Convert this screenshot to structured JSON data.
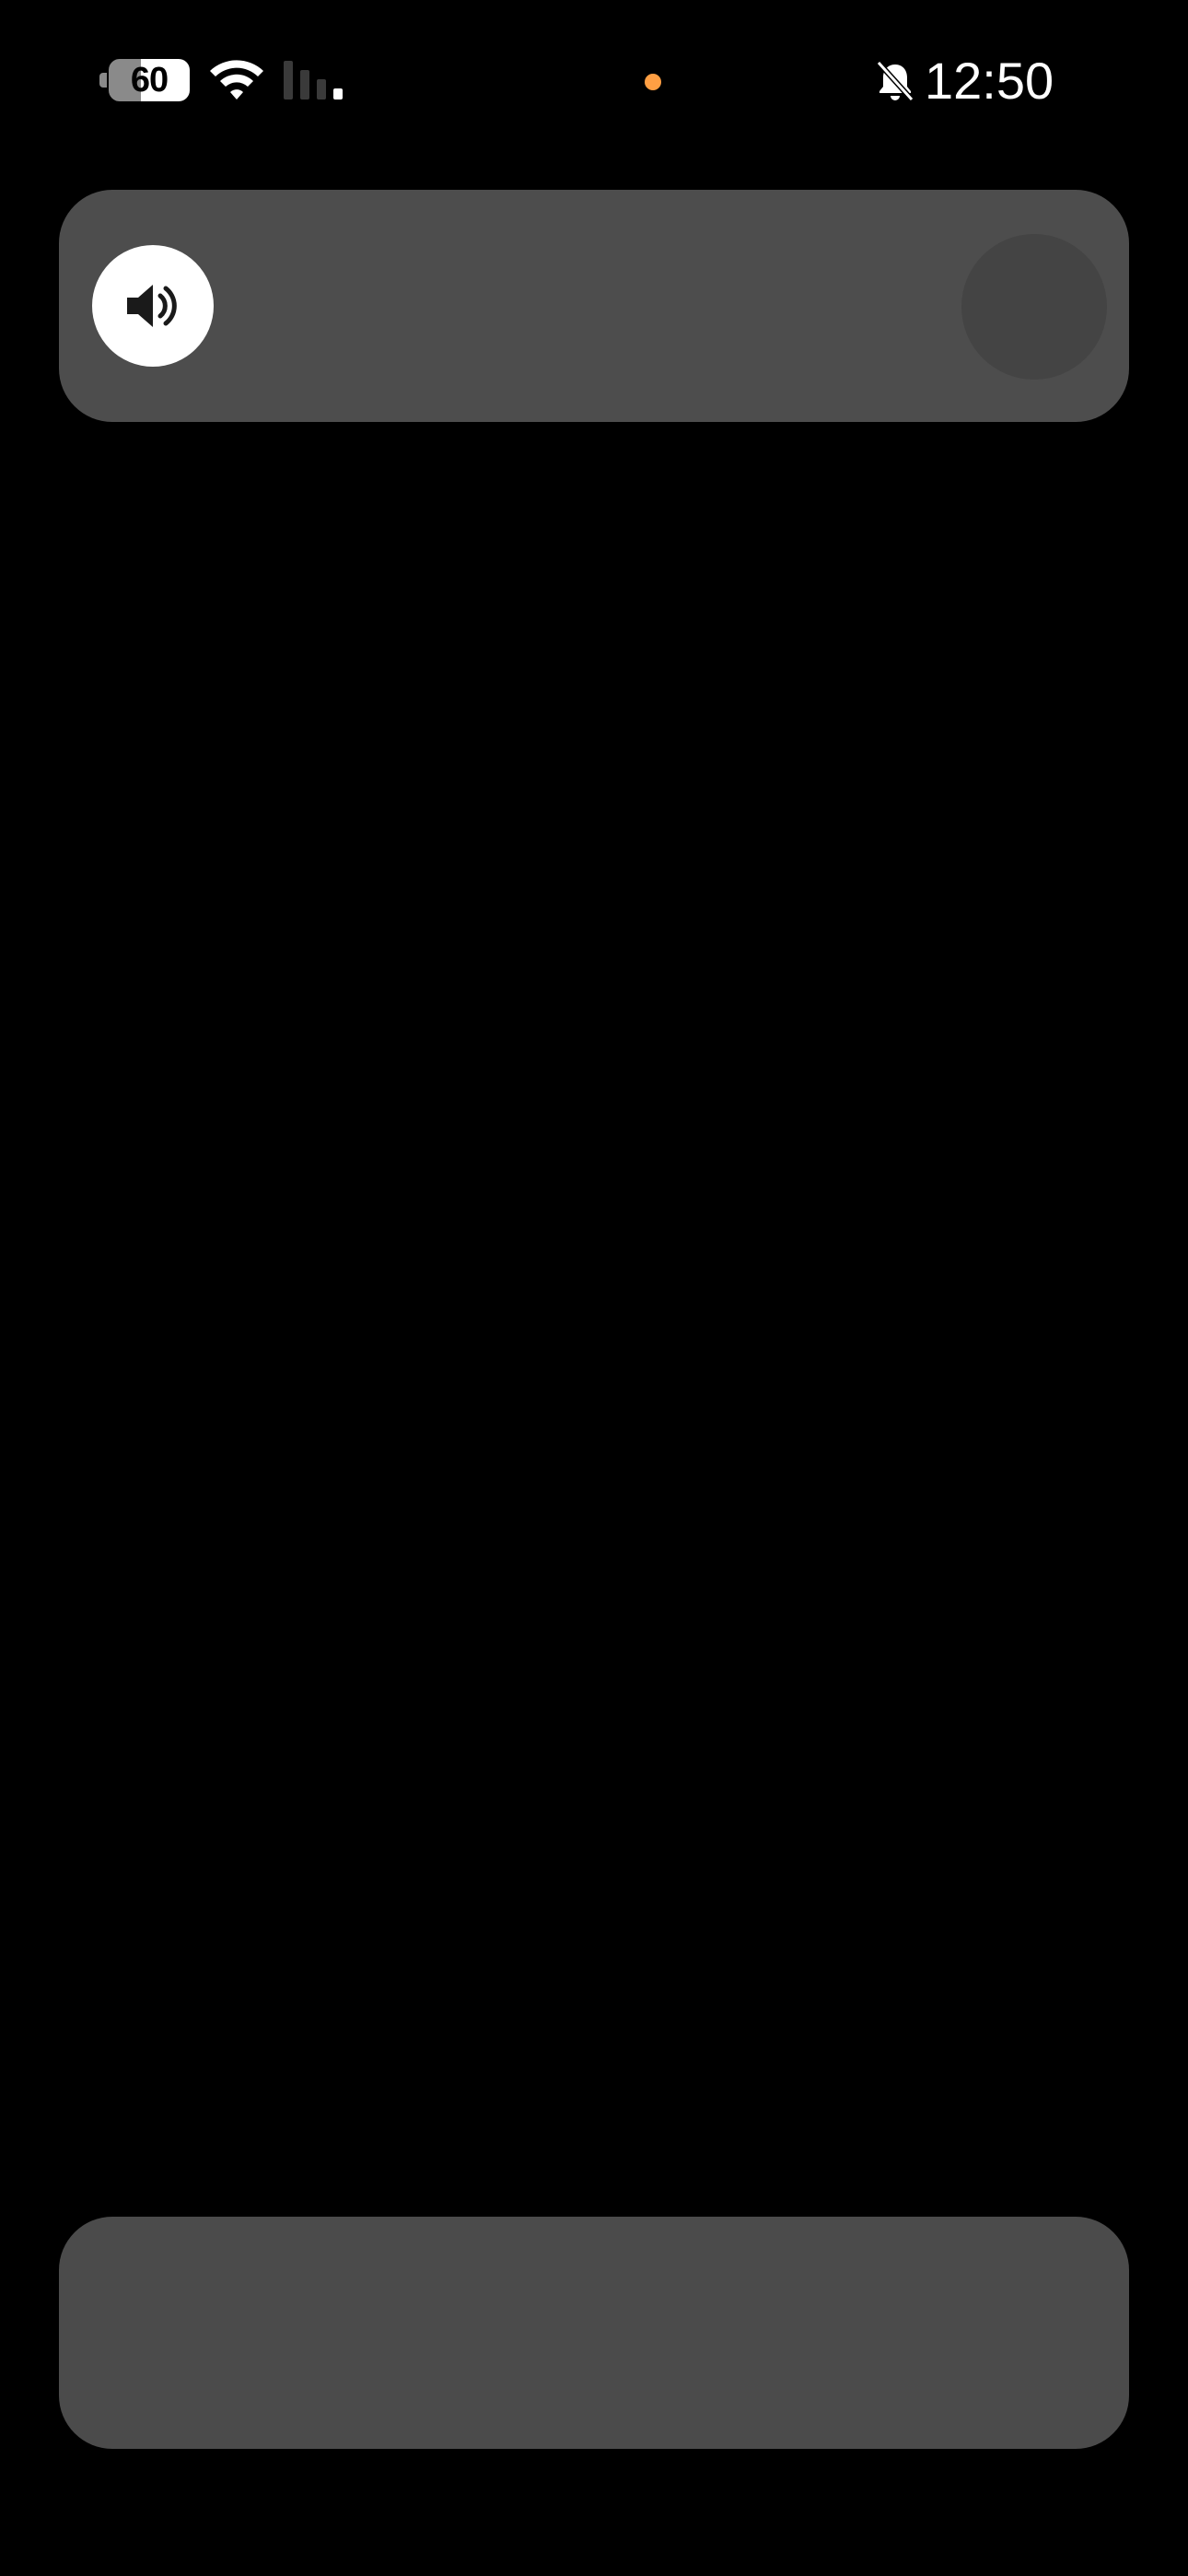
{
  "status_bar": {
    "battery_level": "60",
    "time": "12:50",
    "icons": [
      "battery-icon",
      "wifi-icon",
      "cellular-signal-icon",
      "privacy-indicator-dot",
      "bell-slash-icon"
    ],
    "privacy_dot_color": "#ff9f43"
  },
  "volume_panel": {
    "icon": "speaker-icon",
    "background_color": "#4d4d4d",
    "button_color": "#ffffff",
    "thumb_color": "#444444"
  },
  "bottom_panel": {
    "background_color": "#4b4b4b"
  }
}
